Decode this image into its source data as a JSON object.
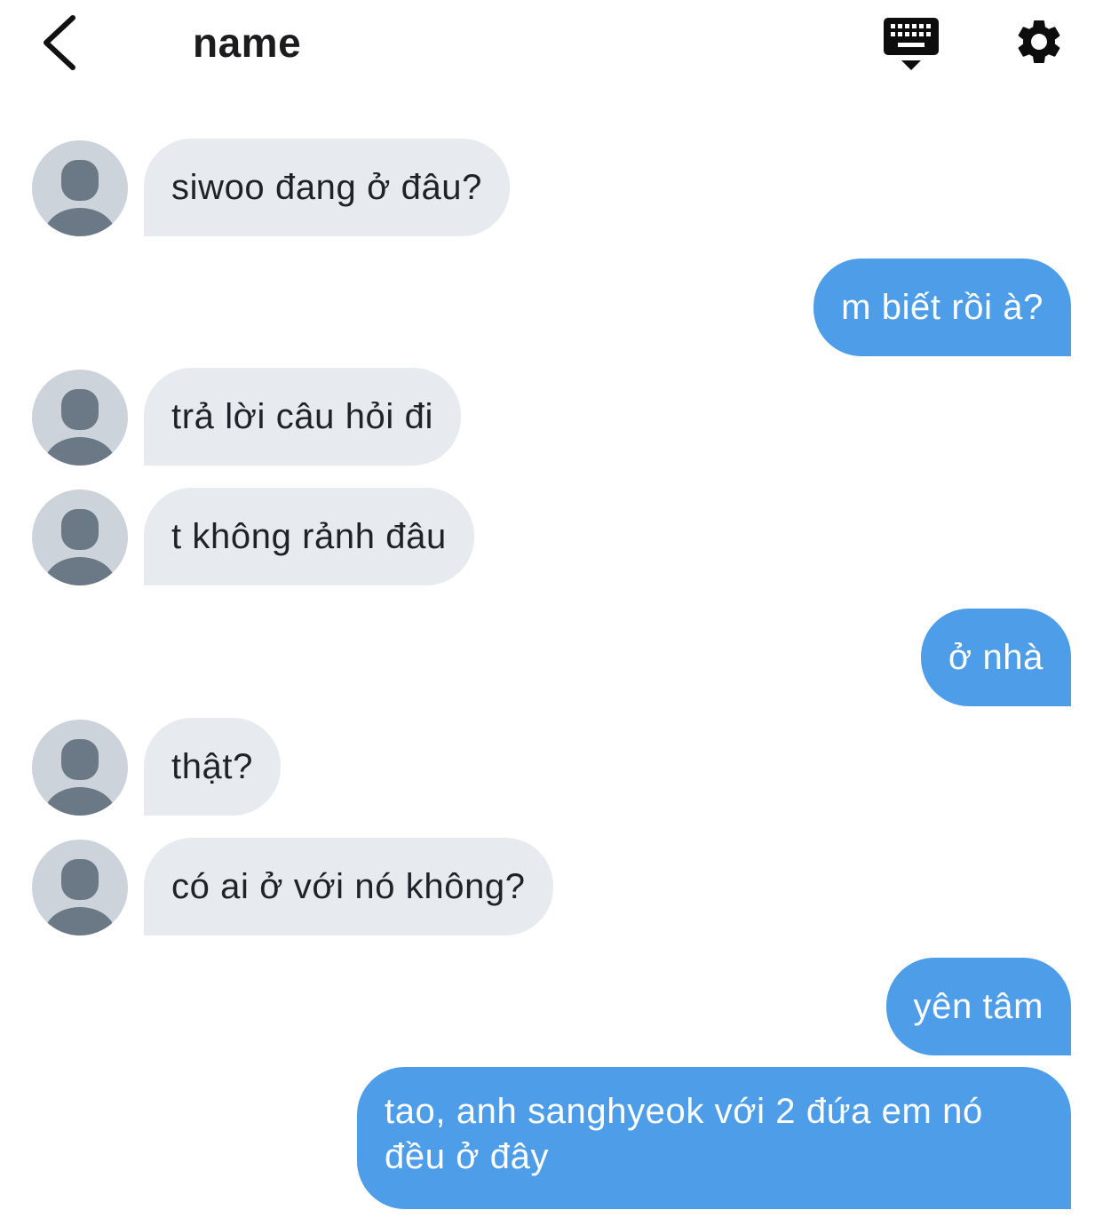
{
  "header": {
    "title": "name"
  },
  "messages": [
    {
      "side": "in",
      "text": "siwoo đang ở đâu?"
    },
    {
      "side": "out",
      "text": "m biết rồi à?"
    },
    {
      "side": "in",
      "text": "trả lời câu hỏi đi"
    },
    {
      "side": "in",
      "text": "t không rảnh đâu"
    },
    {
      "side": "out",
      "text": "ở nhà"
    },
    {
      "side": "in",
      "text": "thật?"
    },
    {
      "side": "in",
      "text": "có ai ở với nó không?"
    },
    {
      "side": "out",
      "text": "yên tâm"
    },
    {
      "side": "out",
      "text": "tao, anh sanghyeok với 2 đứa em nó đều ở đây"
    }
  ],
  "colors": {
    "incoming_bubble": "#e7ebef",
    "outgoing_bubble": "#4e9de8",
    "avatar_bg": "#cdd3da",
    "avatar_fg": "#6b7885"
  }
}
